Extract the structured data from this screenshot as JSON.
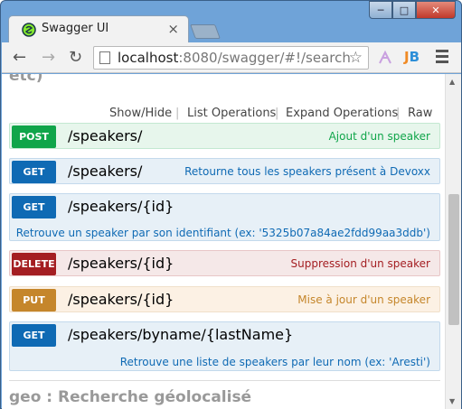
{
  "browser": {
    "tab_title": "Swagger UI",
    "tab_close": "×",
    "url_host": "localhost",
    "url_rest": ":8080/swagger/#!/search",
    "window_buttons": {
      "minimize": "─",
      "maximize": "□",
      "close": "✕"
    },
    "nav": {
      "back": "←",
      "forward": "→",
      "reload": "↻"
    },
    "star": "☆",
    "ext_j": "J",
    "ext_b": "B"
  },
  "section": {
    "cut_heading": "etc)",
    "links": {
      "show_hide": "Show/Hide",
      "list_operations": "List Operations",
      "expand_operations": "Expand Operations",
      "raw": "Raw"
    },
    "separator": "|"
  },
  "operations": [
    {
      "method": "POST",
      "path": "/speakers/",
      "summary": "Ajout d'un speaker"
    },
    {
      "method": "GET",
      "path": "/speakers/",
      "summary": "Retourne tous les speakers présent à Devoxx"
    },
    {
      "method": "GET",
      "path": "/speakers/{id}",
      "summary": "Retrouve un speaker par son identifiant (ex: '5325b07a84ae2fdd99aa3ddb')"
    },
    {
      "method": "DELETE",
      "path": "/speakers/{id}",
      "summary": "Suppression d'un speaker"
    },
    {
      "method": "PUT",
      "path": "/speakers/{id}",
      "summary": "Mise à jour d'un speaker"
    },
    {
      "method": "GET",
      "path": "/speakers/byname/{lastName}",
      "summary": "Retrouve une liste de speakers par leur nom (ex: 'Aresti')"
    }
  ],
  "next_section": {
    "heading": "geo : Recherche géolocalisé"
  },
  "colors": {
    "post": "#10a54a",
    "get": "#0f6ab4",
    "delete": "#a41e22",
    "put": "#c5862b"
  }
}
